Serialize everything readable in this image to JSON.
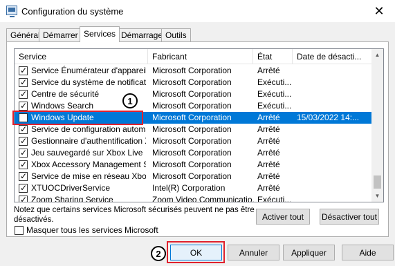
{
  "window": {
    "title": "Configuration du système",
    "close_glyph": "✕"
  },
  "tabs": [
    "Général",
    "Démarrer",
    "Services",
    "Démarrage",
    "Outils"
  ],
  "active_tab": "Services",
  "columns": [
    "Service",
    "Fabricant",
    "État",
    "Date de désacti..."
  ],
  "rows": [
    {
      "checked": true,
      "service": "Service Énumérateur d'appareil ...",
      "vendor": "Microsoft Corporation",
      "state": "Arrêté",
      "date": ""
    },
    {
      "checked": true,
      "service": "Service du système de notificati...",
      "vendor": "Microsoft Corporation",
      "state": "Exécuti...",
      "date": ""
    },
    {
      "checked": true,
      "service": "Centre de sécurité",
      "vendor": "Microsoft Corporation",
      "state": "Exécuti...",
      "date": ""
    },
    {
      "checked": true,
      "service": "Windows Search",
      "vendor": "Microsoft Corporation",
      "state": "Exécuti...",
      "date": ""
    },
    {
      "checked": false,
      "service": "Windows Update",
      "vendor": "Microsoft Corporation",
      "state": "Arrêté",
      "date": "15/03/2022 14:...",
      "selected": true
    },
    {
      "checked": true,
      "service": "Service de configuration automa...",
      "vendor": "Microsoft Corporation",
      "state": "Arrêté",
      "date": ""
    },
    {
      "checked": true,
      "service": "Gestionnaire d'authentification X...",
      "vendor": "Microsoft Corporation",
      "state": "Arrêté",
      "date": ""
    },
    {
      "checked": true,
      "service": "Jeu sauvegardé sur Xbox Live",
      "vendor": "Microsoft Corporation",
      "state": "Arrêté",
      "date": ""
    },
    {
      "checked": true,
      "service": "Xbox Accessory Management Se...",
      "vendor": "Microsoft Corporation",
      "state": "Arrêté",
      "date": ""
    },
    {
      "checked": true,
      "service": "Service de mise en réseau Xbox ...",
      "vendor": "Microsoft Corporation",
      "state": "Arrêté",
      "date": ""
    },
    {
      "checked": true,
      "service": "XTUOCDriverService",
      "vendor": "Intel(R) Corporation",
      "state": "Arrêté",
      "date": ""
    },
    {
      "checked": true,
      "service": "Zoom Sharing Service",
      "vendor": "Zoom Video Communicatio...",
      "state": "Exécuti...",
      "date": ""
    }
  ],
  "note": "Notez que certains services Microsoft sécurisés peuvent ne pas être désactivés.",
  "enable_all_label": "Activer tout",
  "disable_all_label": "Désactiver tout",
  "hide_ms_label": "Masquer tous les services Microsoft",
  "buttons": {
    "ok": "OK",
    "cancel": "Annuler",
    "apply": "Appliquer",
    "help": "Aide"
  },
  "annotations": {
    "step1": "1",
    "step2": "2",
    "highlight_color": "#e0212d"
  },
  "colors": {
    "selection": "#0078d7"
  }
}
